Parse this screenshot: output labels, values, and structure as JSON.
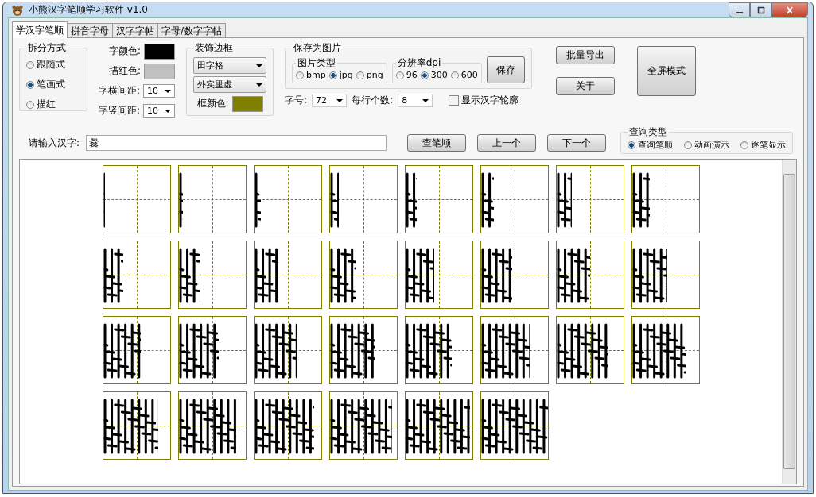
{
  "window": {
    "title": "小熊汉字笔顺学习软件 v1.0"
  },
  "tabs": [
    {
      "label": "学汉字笔顺",
      "selected": true
    },
    {
      "label": "拼音字母",
      "selected": false
    },
    {
      "label": "汉字字帖",
      "selected": false
    },
    {
      "label": "字母/数字字帖",
      "selected": false
    }
  ],
  "split_mode": {
    "title": "拆分方式",
    "options": [
      {
        "label": "跟随式",
        "selected": false
      },
      {
        "label": "笔画式",
        "selected": true
      },
      {
        "label": "描红",
        "selected": false
      }
    ]
  },
  "colors": [
    {
      "label": "字颜色:",
      "color": "#000000"
    },
    {
      "label": "描红色:",
      "color": "#c0c0c0"
    }
  ],
  "spacings": [
    {
      "label": "字横间距:",
      "value": "10"
    },
    {
      "label": "字竖间距:",
      "value": "10"
    }
  ],
  "decoration": {
    "title": "装饰边框",
    "grid_style": "田字格",
    "border_style": "外实里虚",
    "frame_color": {
      "label": "框颜色:",
      "color": "#808000"
    }
  },
  "save": {
    "title": "保存为图片",
    "image_type": {
      "title": "图片类型",
      "options": [
        {
          "label": "bmp",
          "selected": false
        },
        {
          "label": "jpg",
          "selected": true
        },
        {
          "label": "png",
          "selected": false
        }
      ]
    },
    "dpi": {
      "title": "分辨率dpi",
      "options": [
        {
          "label": "96",
          "selected": false
        },
        {
          "label": "300",
          "selected": true
        },
        {
          "label": "600",
          "selected": false
        }
      ]
    },
    "button": "保存"
  },
  "font_size": {
    "label": "字号:",
    "value": "72"
  },
  "per_row": {
    "label": "每行个数:",
    "value": "8"
  },
  "outline": {
    "label": "显示汉字轮廓",
    "checked": false
  },
  "side_buttons": [
    "批量导出",
    "关于"
  ],
  "fullscreen_button": "全屏模式",
  "input": {
    "label": "请输入汉字:",
    "value": "爨"
  },
  "query_buttons": [
    "查笔顺",
    "上一个",
    "下一个"
  ],
  "query_type": {
    "title": "查询类型",
    "options": [
      {
        "label": "查询笔顺",
        "selected": true
      },
      {
        "label": "动画演示",
        "selected": false
      },
      {
        "label": "逐笔显示",
        "selected": false
      }
    ]
  },
  "stroke_grid": {
    "cells": [
      {
        "level": 0.033
      },
      {
        "level": 0.067
      },
      {
        "level": 0.1
      },
      {
        "level": 0.133
      },
      {
        "level": 0.167
      },
      {
        "level": 0.2
      },
      {
        "level": 0.233
      },
      {
        "level": 0.267
      },
      {
        "level": 0.3
      },
      {
        "level": 0.333
      },
      {
        "level": 0.367
      },
      {
        "level": 0.4
      },
      {
        "level": 0.433
      },
      {
        "level": 0.467
      },
      {
        "level": 0.5
      },
      {
        "level": 0.533
      },
      {
        "level": 0.567
      },
      {
        "level": 0.6
      },
      {
        "level": 0.633
      },
      {
        "level": 0.667
      },
      {
        "level": 0.7
      },
      {
        "level": 0.733
      },
      {
        "level": 0.767
      },
      {
        "level": 0.8
      },
      {
        "level": 0.833
      },
      {
        "level": 0.867
      },
      {
        "level": 0.9
      },
      {
        "level": 0.933
      },
      {
        "level": 0.967
      },
      {
        "level": 1
      }
    ]
  }
}
